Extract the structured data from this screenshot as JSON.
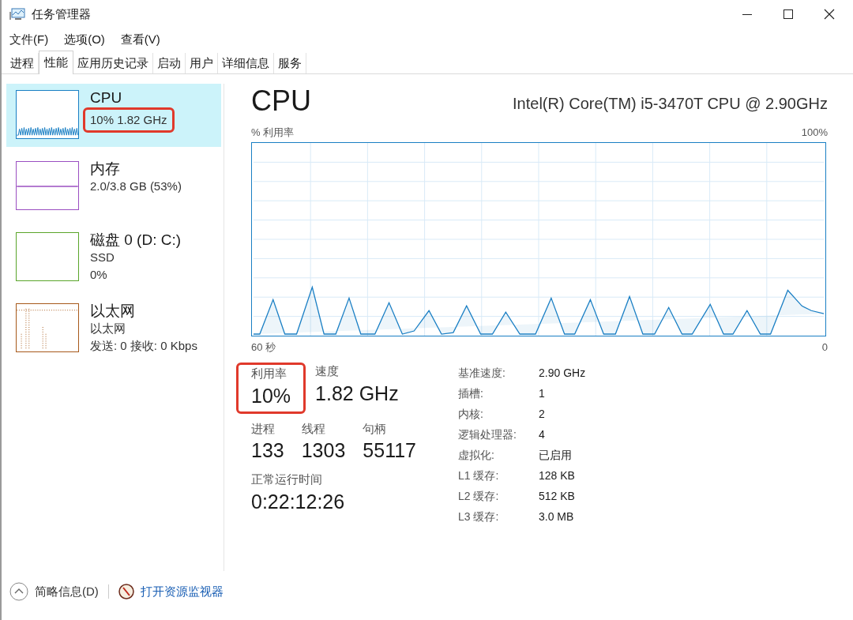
{
  "window": {
    "title": "任务管理器"
  },
  "menu": [
    "文件(F)",
    "选项(O)",
    "查看(V)"
  ],
  "tabs": [
    {
      "label": "进程",
      "selected": false
    },
    {
      "label": "性能",
      "selected": true
    },
    {
      "label": "应用历史记录",
      "selected": false
    },
    {
      "label": "启动",
      "selected": false
    },
    {
      "label": "用户",
      "selected": false
    },
    {
      "label": "详细信息",
      "selected": false
    },
    {
      "label": "服务",
      "selected": false
    }
  ],
  "sidebar": {
    "items": [
      {
        "kind": "cpu",
        "title": "CPU",
        "lines": [
          "10% 1.82 GHz"
        ],
        "selected": true,
        "highlighted": true,
        "color": "#1a7fc4"
      },
      {
        "kind": "memory",
        "title": "内存",
        "lines": [
          "2.0/3.8 GB (53%)"
        ],
        "selected": false,
        "highlighted": false,
        "color": "#9b4fc1"
      },
      {
        "kind": "disk",
        "title": "磁盘 0 (D: C:)",
        "lines": [
          "SSD",
          "0%"
        ],
        "selected": false,
        "highlighted": false,
        "color": "#5aa52a"
      },
      {
        "kind": "network",
        "title": "以太网",
        "lines": [
          "以太网",
          "发送: 0 接收: 0 Kbps"
        ],
        "selected": false,
        "highlighted": false,
        "color": "#a7591a"
      }
    ]
  },
  "main": {
    "title": "CPU",
    "processor": "Intel(R) Core(TM) i5-3470T CPU @ 2.90GHz",
    "graph": {
      "ylabel": "% 利用率",
      "ymax": "100%",
      "xstart": "60 秒",
      "xend": "0"
    },
    "stats": [
      {
        "label": "利用率",
        "value": "10%",
        "highlighted": true
      },
      {
        "label": "速度",
        "value": "1.82 GHz",
        "highlighted": false
      }
    ],
    "counts": [
      {
        "label": "进程",
        "value": "133"
      },
      {
        "label": "线程",
        "value": "1303"
      },
      {
        "label": "句柄",
        "value": "55117"
      }
    ],
    "uptime": {
      "label": "正常运行时间",
      "value": "0:22:12:26"
    },
    "details": [
      {
        "label": "基准速度:",
        "value": "2.90 GHz"
      },
      {
        "label": "插槽:",
        "value": "1"
      },
      {
        "label": "内核:",
        "value": "2"
      },
      {
        "label": "逻辑处理器:",
        "value": "4"
      },
      {
        "label": "虚拟化:",
        "value": "已启用"
      },
      {
        "label": "L1 缓存:",
        "value": "128 KB"
      },
      {
        "label": "L2 缓存:",
        "value": "512 KB"
      },
      {
        "label": "L3 缓存:",
        "value": "3.0 MB"
      }
    ]
  },
  "footer": {
    "summary": "简略信息(D)",
    "monitor_link": "打开资源监视器"
  }
}
